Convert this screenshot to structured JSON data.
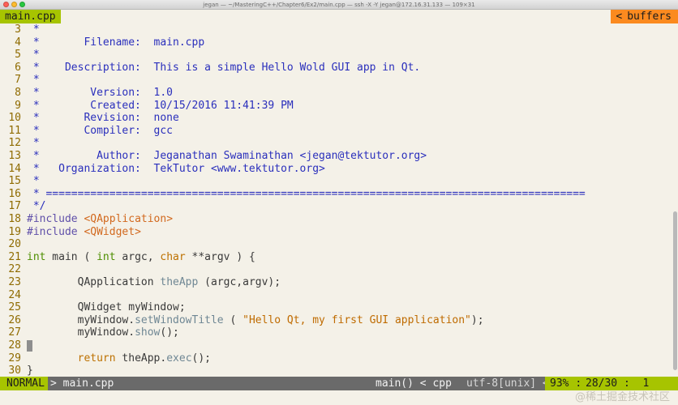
{
  "window": {
    "title": "jegan — ~/MasteringC++/Chapter6/Ex2/main.cpp — ssh -X -Y jegan@172.16.31.133 — 109×31"
  },
  "tabline": {
    "active_tab": "main.cpp",
    "buffers_label": "buffers",
    "buffers_arrow": "<"
  },
  "editor": {
    "lines": [
      {
        "num": "3",
        "text": " *"
      },
      {
        "num": "4",
        "text": " *       Filename:  main.cpp"
      },
      {
        "num": "5",
        "text": " *"
      },
      {
        "num": "6",
        "text": " *    Description:  This is a simple Hello Wold GUI app in Qt."
      },
      {
        "num": "7",
        "text": " *"
      },
      {
        "num": "8",
        "text": " *        Version:  1.0"
      },
      {
        "num": "9",
        "text": " *        Created:  10/15/2016 11:41:39 PM"
      },
      {
        "num": "10",
        "text": " *       Revision:  none"
      },
      {
        "num": "11",
        "text": " *       Compiler:  gcc"
      },
      {
        "num": "12",
        "text": " *"
      },
      {
        "num": "13",
        "text": " *         Author:  Jeganathan Swaminathan <jegan@tektutor.org>"
      },
      {
        "num": "14",
        "text": " *   Organization:  TekTutor <www.tektutor.org>"
      },
      {
        "num": "15",
        "text": " *"
      },
      {
        "num": "16",
        "text": " * ====================================================================================="
      },
      {
        "num": "17",
        "text": " */"
      },
      {
        "num": "18",
        "pre": "#include ",
        "target": "<QApplication>"
      },
      {
        "num": "19",
        "pre": "#include ",
        "target": "<QWidget>"
      },
      {
        "num": "20",
        "text": ""
      },
      {
        "num": "21",
        "t1": "int",
        "t2": " main ( ",
        "t3": "int",
        "t4": " argc, ",
        "t5": "char",
        "t6": " **argv ) {"
      },
      {
        "num": "22",
        "text": ""
      },
      {
        "num": "23",
        "a": "        QApplication ",
        "b": "theApp",
        "c": " (argc,argv);"
      },
      {
        "num": "24",
        "text": ""
      },
      {
        "num": "25",
        "text": "        QWidget myWindow;"
      },
      {
        "num": "26",
        "a": "        myWindow.",
        "b": "setWindowTitle",
        "c": " ( ",
        "d": "\"Hello Qt, my first GUI application\"",
        "e": ");"
      },
      {
        "num": "27",
        "a": "        myWindow.",
        "b": "show",
        "c": "();"
      },
      {
        "num": "28",
        "text": ""
      },
      {
        "num": "29",
        "kw": "return",
        "a": " theApp.",
        "b": "exec",
        "c": "();"
      },
      {
        "num": "30",
        "text": "}"
      }
    ]
  },
  "statusline": {
    "mode": "NORMAL",
    "arrow": ">",
    "filename": "main.cpp",
    "function": "main() < cpp",
    "encoding": "utf-8[unix]",
    "enc_arrow": "<",
    "percent": "93%",
    "sep": ":",
    "position": "28/30",
    "colon2": ":",
    "colnum": "1"
  },
  "watermark": "@稀土掘金技术社区",
  "colors": {
    "background": "#f4f1e8",
    "accent_green": "#a7c400",
    "accent_orange": "#fb8a1f",
    "comment": "#2a2fbc",
    "line_number": "#8f6b00",
    "type": "#4d8e00",
    "keyword": "#bd7100"
  }
}
